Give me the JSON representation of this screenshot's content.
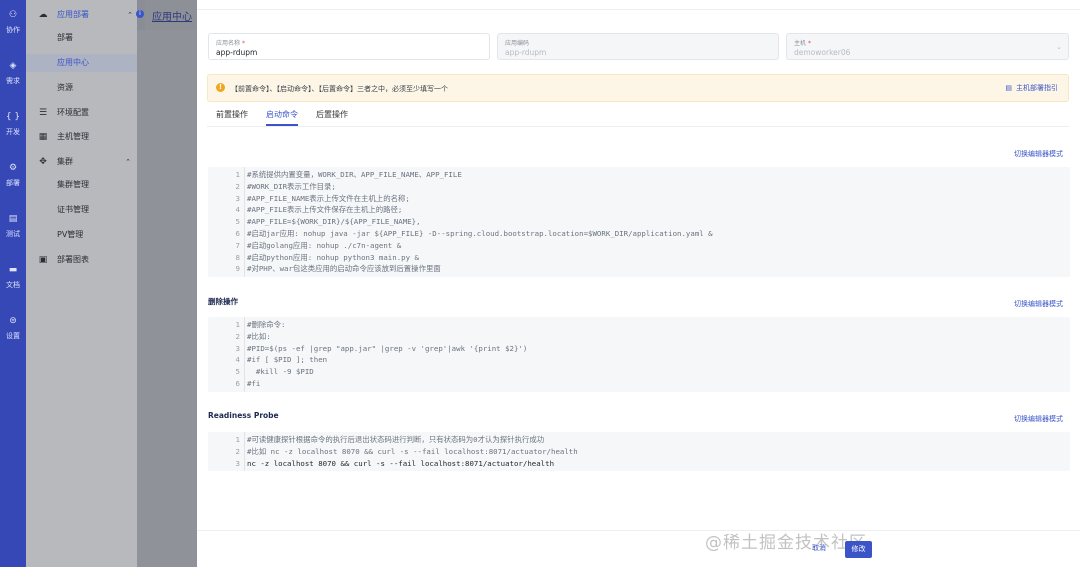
{
  "rail": [
    {
      "icon": "handshake-icon",
      "glyph": "⚇",
      "label": "协作"
    },
    {
      "icon": "cube-icon",
      "glyph": "◈",
      "label": "需求"
    },
    {
      "icon": "code-icon",
      "glyph": "{ }",
      "label": "开发"
    },
    {
      "icon": "deploy-icon",
      "glyph": "⚙",
      "label": "部署"
    },
    {
      "icon": "test-icon",
      "glyph": "▤",
      "label": "测试"
    },
    {
      "icon": "docs-icon",
      "glyph": "▬",
      "label": "文档"
    },
    {
      "icon": "settings-icon",
      "glyph": "⊜",
      "label": "设置"
    }
  ],
  "sidebar": {
    "group_title": "应用部署",
    "items": [
      {
        "label": "部署"
      },
      {
        "label": "应用中心"
      },
      {
        "label": "资源"
      },
      {
        "label": "环境配置"
      },
      {
        "label": "主机管理"
      },
      {
        "label": "集群"
      },
      {
        "label": "集群管理"
      },
      {
        "label": "证书管理"
      },
      {
        "label": "PV管理"
      },
      {
        "label": "部署图表"
      }
    ]
  },
  "background": {
    "page_title": "应用中心"
  },
  "form": {
    "app_name": {
      "label": "应用名称",
      "value": "app-rdupm"
    },
    "app_code": {
      "label": "应用编码",
      "value": "app-rdupm"
    },
    "host": {
      "label": "主机",
      "value": "demoworker06"
    }
  },
  "notice": {
    "message": "【前置命令】、【启动命令】、【后置命令】三者之中，必须至少填写一个",
    "guide_label": "主机部署指引"
  },
  "tabs": [
    {
      "label": "前置操作"
    },
    {
      "label": "启动命令"
    },
    {
      "label": "后置操作"
    }
  ],
  "editors": {
    "switch_label": "切换编辑器模式",
    "start": {
      "lines": [
        "#系统提供内置变量，WORK_DIR、APP_FILE_NAME、APP_FILE",
        "#WORK_DIR表示工作目录;",
        "#APP_FILE_NAME表示上传文件在主机上的名称;",
        "#APP_FILE表示上传文件保存在主机上的路径;",
        "#APP_FILE=${WORK_DIR}/${APP_FILE_NAME},",
        "#启动jar应用: nohup java -jar ${APP_FILE} -D--spring.cloud.bootstrap.location=$WORK_DIR/application.yaml &",
        "#启动golang应用: nohup ./c7n-agent &",
        "#启动python应用: nohup python3 main.py &",
        "#对PHP、war包这类应用的启动命令应该放到后置操作里面"
      ]
    },
    "delete": {
      "title": "删除操作",
      "lines": [
        "#删除命令:",
        "#比如:",
        "#PID=$(ps -ef |grep \"app.jar\" |grep -v 'grep'|awk '{print $2}')",
        "#if [ $PID ]; then",
        "  #kill -9 $PID",
        "#fi"
      ]
    },
    "readiness": {
      "title": "Readiness Probe",
      "lines": [
        "#可读健康探针根据命令的执行后退出状态码进行判断，只有状态码为0才认为探针执行成功",
        "#比如 nc -z localhost 8070 && curl -s --fail localhost:8071/actuator/health",
        "nc -z localhost 8070 && curl -s --fail localhost:8071/actuator/health"
      ]
    }
  },
  "footer": {
    "cancel_label": "取消",
    "save_label": "修改"
  },
  "watermark": "@稀土掘金技术社区",
  "colors": {
    "accent": "#3b55c9",
    "rail": "#3548b5",
    "warning": "#f0a61f"
  }
}
